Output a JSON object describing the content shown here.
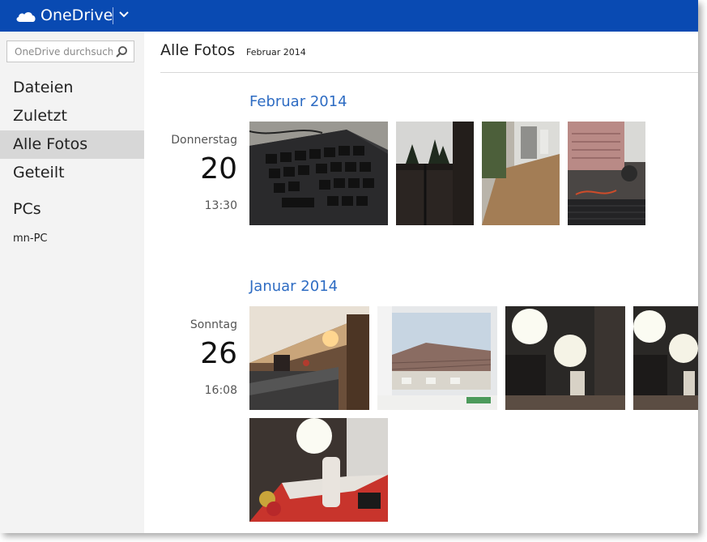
{
  "header": {
    "brand": "OneDrive"
  },
  "sidebar": {
    "search_placeholder": "OneDrive durchsuchen",
    "items": [
      {
        "label": "Dateien"
      },
      {
        "label": "Zuletzt"
      },
      {
        "label": "Alle Fotos",
        "active": true
      },
      {
        "label": "Geteilt"
      }
    ],
    "pcs_heading": "PCs",
    "pcs": [
      {
        "label": "mn-PC"
      }
    ]
  },
  "main": {
    "title": "Alle Fotos",
    "crumb": "Februar 2014",
    "groups": [
      {
        "month": "Februar 2014",
        "day_name": "Donnerstag",
        "day_number": "20",
        "time": "13:30",
        "photos": [
          {
            "subject": "keyboard"
          },
          {
            "subject": "trees-window"
          },
          {
            "subject": "hallway-floor"
          },
          {
            "subject": "monitor-desk"
          }
        ]
      },
      {
        "month": "Januar 2014",
        "day_name": "Sonntag",
        "day_number": "26",
        "time": "16:08",
        "photos": [
          {
            "subject": "kitchen-attic"
          },
          {
            "subject": "rooftop-window"
          },
          {
            "subject": "lamp-bottle"
          },
          {
            "subject": "lamp-bottle-2"
          },
          {
            "subject": "christmas-table"
          }
        ]
      }
    ]
  },
  "colors": {
    "topbar": "#094ab2",
    "month": "#2e6cc3",
    "sidebar": "#f3f3f3",
    "active": "#d7d7d7"
  }
}
